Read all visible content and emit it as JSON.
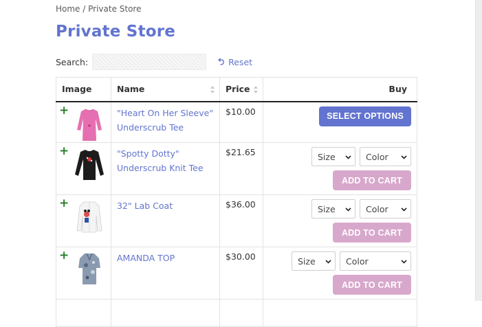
{
  "breadcrumb": {
    "home": "Home",
    "separator": " / ",
    "current": "Private Store"
  },
  "page": {
    "title": "Private Store"
  },
  "search": {
    "label": "Search:",
    "value": "",
    "placeholder": "",
    "reset_label": "Reset"
  },
  "table": {
    "headers": {
      "image": "Image",
      "name": "Name",
      "price": "Price",
      "buy": "Buy"
    },
    "rows": [
      {
        "name_line1": "\"Heart On Her Sleeve\"",
        "name_line2": "Underscrub Tee",
        "price": "$10.00",
        "action": "SELECT OPTIONS",
        "image": "pink-long-sleeve-top"
      },
      {
        "name_line1": "\"Spotty Dotty\"",
        "name_line2": "Underscrub Knit Tee",
        "price": "$21.65",
        "size": "Size",
        "color": "Color",
        "action": "ADD TO CART",
        "image": "black-long-sleeve-tee"
      },
      {
        "name_line1": "32\" Lab Coat",
        "name_line2": "",
        "price": "$36.00",
        "size": "Size",
        "color": "Color",
        "action": "ADD TO CART",
        "image": "white-lab-coat"
      },
      {
        "name_line1": "AMANDA TOP",
        "name_line2": "",
        "price": "$30.00",
        "size": "Size",
        "color": "Color",
        "action": "ADD TO CART",
        "image": "printed-scrub-top"
      }
    ]
  },
  "colors": {
    "accent": "#6274cf",
    "cart_button": "#d8a8cc",
    "plus": "#2a7f2a"
  }
}
